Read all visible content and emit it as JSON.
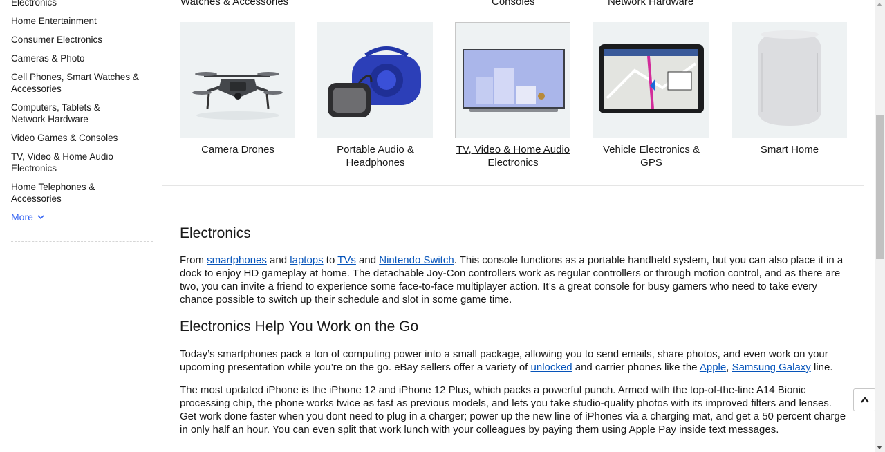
{
  "sidebar": {
    "partial_item": "Electronics",
    "items": [
      "Home Entertainment",
      "Consumer Electronics",
      "Cameras & Photo",
      "Cell Phones, Smart Watches & Accessories",
      "Computers, Tablets & Network Hardware",
      "Video Games & Consoles",
      "TV, Video & Home Audio Electronics",
      "Home Telephones & Accessories"
    ],
    "more_label": "More"
  },
  "top_cut_labels": [
    "Watches & Accessories",
    "Consoles",
    "Network Hardware"
  ],
  "tiles": [
    {
      "label": "Camera Drones"
    },
    {
      "label": "Portable Audio & Headphones"
    },
    {
      "label": "TV, Video & Home Audio Electronics"
    },
    {
      "label": "Vehicle Electronics & GPS"
    },
    {
      "label": "Smart Home"
    }
  ],
  "article": {
    "h1": "Electronics",
    "p1": {
      "t0": "From ",
      "l0": "smartphones",
      "t1": " and ",
      "l1": "laptops",
      "t2": " to ",
      "l2": "TVs",
      "t3": " and ",
      "l3": "Nintendo Switch",
      "t4": ". This console functions as a portable handheld system, but you can also place it in a dock to enjoy HD gameplay at home. The detachable Joy-Con controllers work as regular controllers or through motion control, and as there are two, you can invite a friend to experience some face-to-face multiplayer action. It’s a great console for busy gamers who need to take every chance possible to switch up their schedule and slot in some game time."
    },
    "h2": "Electronics Help You Work on the Go",
    "p2": {
      "t0": "Today’s smartphones pack a ton of computing power into a small package, allowing you to send emails, share photos, and even work on your upcoming presentation while you’re on the go. eBay sellers offer a variety of ",
      "l0": "unlocked",
      "t1": " and carrier phones like the ",
      "l1": "Apple",
      "t2": ", ",
      "l2": "Samsung Galaxy",
      "t3": " line."
    },
    "p3": "The most updated iPhone is the iPhone 12 and iPhone 12 Plus, which packs a powerful punch. Armed with the top-of-the-line A14 Bionic processing chip, the phone works twice as fast as previous models, and lets you take studio-quality photos with its improved filters and lenses. Get work done faster when you dont need to plug in a charger; power up the new line of iPhones via a charging mat, and get a 50 percent charge in only half an hour. You can even split that work lunch with your colleagues by paying them using Apple Pay inside text messages."
  },
  "colors": {
    "link": "#0654ba",
    "more": "#3665f3",
    "text": "#191919"
  }
}
